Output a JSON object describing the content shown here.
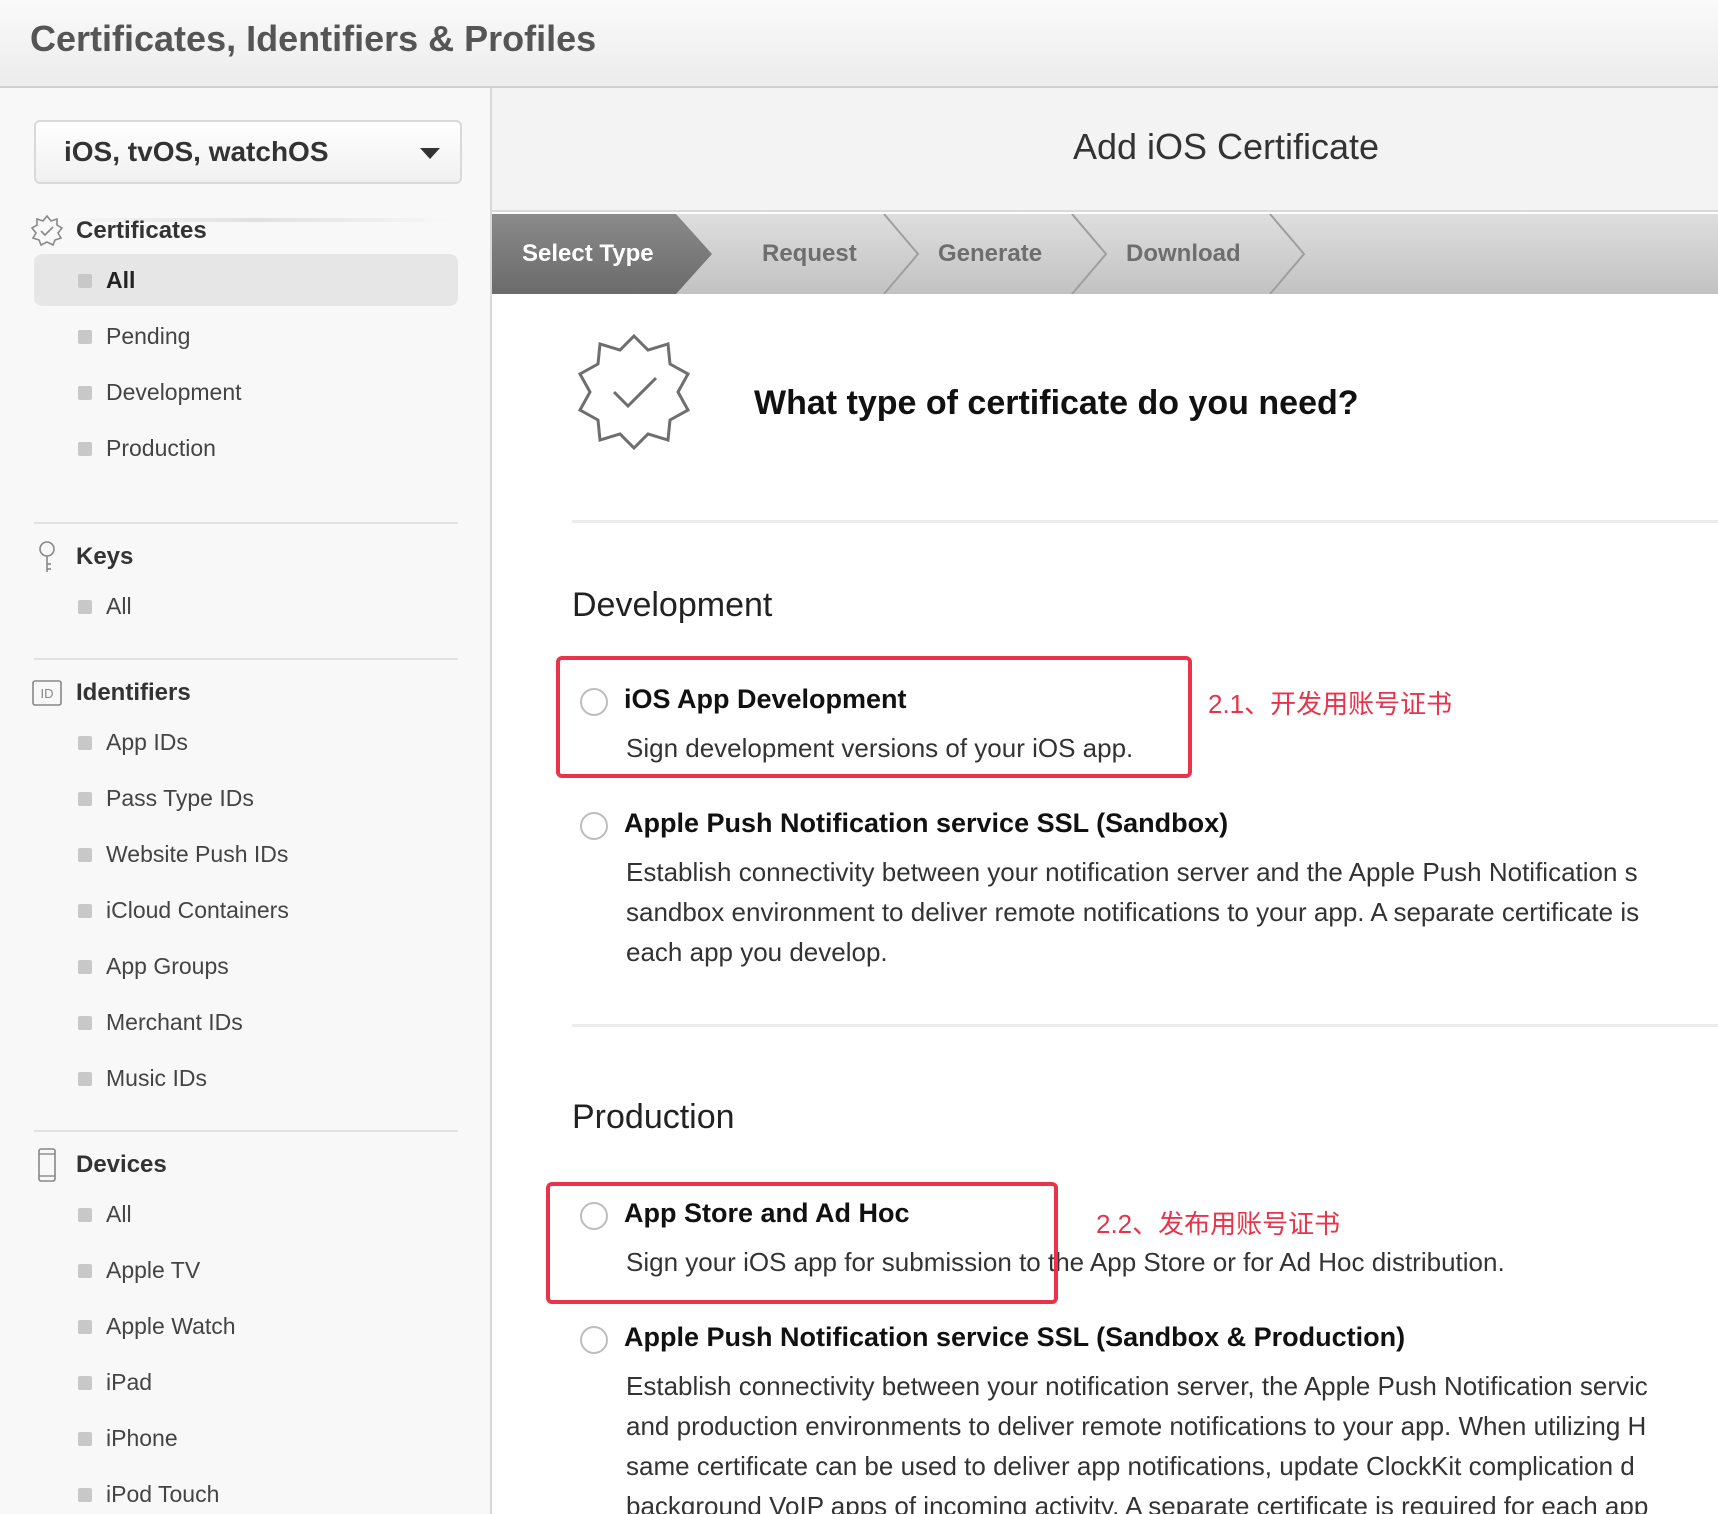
{
  "header": {
    "title": "Certificates, Identifiers & Profiles"
  },
  "sidebar": {
    "platform": "iOS, tvOS, watchOS",
    "sections": {
      "certificates": {
        "title": "Certificates",
        "items": [
          "All",
          "Pending",
          "Development",
          "Production"
        ]
      },
      "keys": {
        "title": "Keys",
        "items": [
          "All"
        ]
      },
      "identifiers": {
        "title": "Identifiers",
        "icon_text": "ID",
        "items": [
          "App IDs",
          "Pass Type IDs",
          "Website Push IDs",
          "iCloud Containers",
          "App Groups",
          "Merchant IDs",
          "Music IDs"
        ]
      },
      "devices": {
        "title": "Devices",
        "items": [
          "All",
          "Apple TV",
          "Apple Watch",
          "iPad",
          "iPhone",
          "iPod Touch"
        ]
      }
    }
  },
  "main": {
    "title": "Add iOS Certificate",
    "steps": [
      "Select Type",
      "Request",
      "Generate",
      "Download"
    ],
    "question": "What type of certificate do you need?",
    "development": {
      "title": "Development",
      "options": [
        {
          "title": "iOS App Development",
          "desc": [
            "Sign development versions of your iOS app."
          ]
        },
        {
          "title": "Apple Push Notification service SSL (Sandbox)",
          "desc": [
            "Establish connectivity between your notification server and the Apple Push Notification s",
            "sandbox environment to deliver remote notifications to your app. A separate certificate is",
            "each app you develop."
          ]
        }
      ]
    },
    "production": {
      "title": "Production",
      "options": [
        {
          "title": "App Store and Ad Hoc",
          "desc": [
            "Sign your iOS app for submission to the App Store or for Ad Hoc distribution."
          ]
        },
        {
          "title": "Apple Push Notification service SSL (Sandbox & Production)",
          "desc": [
            "Establish connectivity between your notification server, the Apple Push Notification servic",
            "and production environments to deliver remote notifications to your app. When utilizing H",
            "same certificate can be used to deliver app notifications, update ClockKit complication d",
            "background VoIP apps of incoming activity. A separate certificate is required for each app"
          ]
        }
      ]
    },
    "annotations": {
      "dev": "2.1、开发用账号证书",
      "prod": "2.2、发布用账号证书"
    },
    "colors": {
      "annotation": "#e8334a"
    }
  }
}
